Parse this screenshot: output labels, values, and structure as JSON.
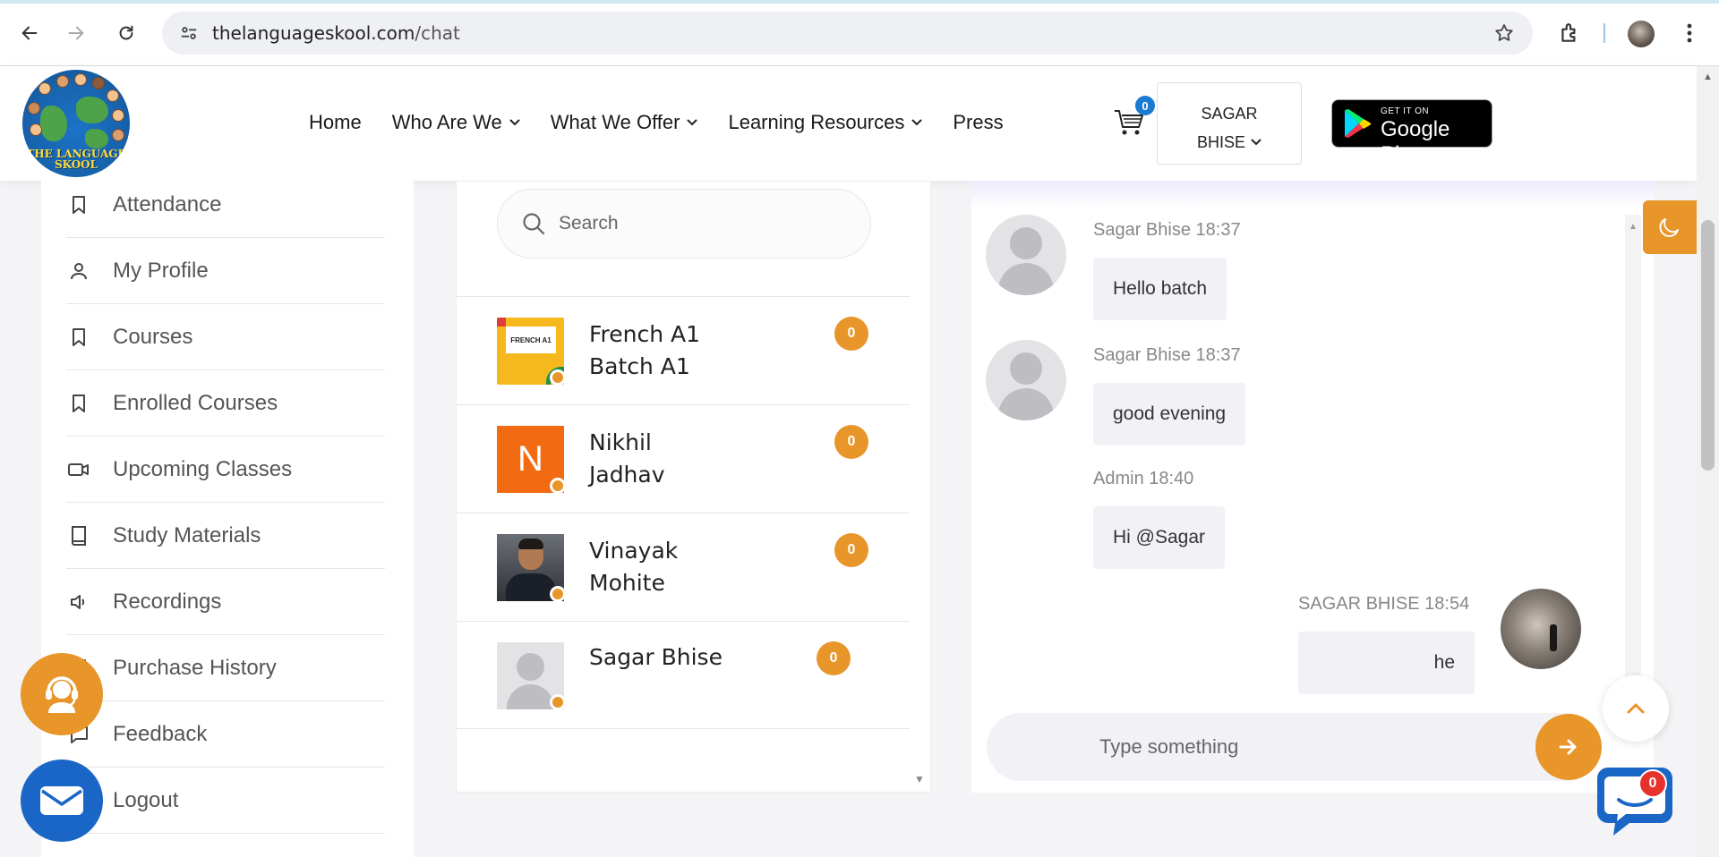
{
  "browser": {
    "url_domain": "thelanguageskool.com",
    "url_path": "/chat",
    "icons": [
      "back-icon",
      "forward-icon",
      "reload-icon",
      "site-settings-icon",
      "bookmark-star-icon",
      "extensions-icon",
      "profile-avatar",
      "menu-icon"
    ]
  },
  "header": {
    "logo_text_line1": "THE LANGUAGE",
    "logo_text_line2": "SKOOL",
    "nav": [
      {
        "label": "Home"
      },
      {
        "label": "Who Are We"
      },
      {
        "label": "What We Offer"
      },
      {
        "label": "Learning Resources"
      },
      {
        "label": "Press"
      }
    ],
    "cart_count": "0",
    "user_line1": "SAGAR",
    "user_line2": "BHISE",
    "play_small": "GET IT ON",
    "play_big": "Google Play"
  },
  "sidebar": {
    "items": [
      {
        "label": "Attendance",
        "icon": "bookmark-icon"
      },
      {
        "label": "My Profile",
        "icon": "user-icon"
      },
      {
        "label": "Courses",
        "icon": "bookmark-icon"
      },
      {
        "label": "Enrolled Courses",
        "icon": "bookmark-icon"
      },
      {
        "label": "Upcoming Classes",
        "icon": "video-icon"
      },
      {
        "label": "Study Materials",
        "icon": "book-icon"
      },
      {
        "label": "Recordings",
        "icon": "speaker-icon"
      },
      {
        "label": "Purchase History",
        "icon": "receipt-icon"
      },
      {
        "label": "Feedback",
        "icon": "comment-icon"
      },
      {
        "label": "Logout",
        "icon": "logout-icon"
      }
    ]
  },
  "chat_list": {
    "search_placeholder": "Search",
    "contacts": [
      {
        "line1": "French A1",
        "line2": "Batch A1",
        "count": "0",
        "thumb_text": "FRENCH A1"
      },
      {
        "line1": "Nikhil",
        "line2": "Jadhav",
        "count": "0",
        "initial": "N"
      },
      {
        "line1": "Vinayak",
        "line2": "Mohite",
        "count": "0"
      },
      {
        "line1": "Sagar Bhise",
        "line2": "",
        "count": "0"
      }
    ]
  },
  "chat": {
    "messages": [
      {
        "meta": "Sagar Bhise 18:37",
        "text": "Hello batch",
        "side": "left"
      },
      {
        "meta": "Sagar Bhise 18:37",
        "text": "good evening",
        "side": "left"
      },
      {
        "meta": "Admin 18:40",
        "text": "Hi @Sagar",
        "side": "left"
      },
      {
        "meta": "SAGAR BHISE 18:54",
        "text": "he",
        "side": "right"
      }
    ],
    "input_placeholder": "Type something"
  },
  "widgets": {
    "chat_widget_count": "0"
  },
  "colors": {
    "accent": "#e8952a",
    "blue": "#1a66c6",
    "badge_red": "#e5322d"
  }
}
